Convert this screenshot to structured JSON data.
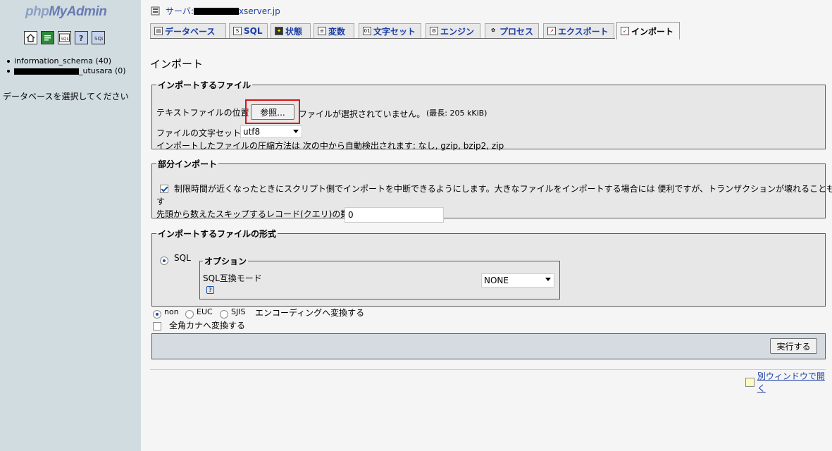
{
  "logo": {
    "part1": "php",
    "part2": "MyAdmin"
  },
  "nav_icons": [
    "home-icon",
    "query-window-icon",
    "sql-docs-icon",
    "help-icon",
    "documentation-icon"
  ],
  "sidebar": {
    "databases": [
      {
        "label": "information_schema (40)"
      },
      {
        "label_suffix": "_utusara (0)"
      }
    ],
    "select_prompt": "データベースを選択してください"
  },
  "server": {
    "prefix": "サーバ: ",
    "suffix": "xserver.jp"
  },
  "tabs": [
    {
      "label": "データベース"
    },
    {
      "label": "SQL"
    },
    {
      "label": "状態"
    },
    {
      "label": "変数"
    },
    {
      "label": "文字セット"
    },
    {
      "label": "エンジン"
    },
    {
      "label": "プロセス"
    },
    {
      "label": "エクスポート"
    },
    {
      "label": "インポート"
    }
  ],
  "page_title": "インポート",
  "file_section": {
    "legend": "インポートするファイル",
    "location_label": "テキストファイルの位置",
    "browse_button": "参照...",
    "no_file_text": "ファイルが選択されていません。",
    "max_size": "(最長: 205 kKiB)",
    "charset_label": "ファイルの文字セット:",
    "charset_value": "utf8",
    "compression_text": "インポートしたファイルの圧縮方法は 次の中から自動検出されます: なし, gzip, bzip2, zip"
  },
  "partial_section": {
    "legend": "部分インポート",
    "interrupt_text_line1": "制限時間が近くなったときにスクリプト側でインポートを中断できるようにします。大きなファイルをインポートする場合には 便利ですが、トランザクションが壊れることもありま",
    "interrupt_text_line2": "す",
    "interrupt_checked": true,
    "skip_label": "先頭から数えたスキップするレコード(クエリ)の数",
    "skip_value": "0"
  },
  "format_section": {
    "legend": "インポートするファイルの形式",
    "sql_label": "SQL",
    "sql_checked": true,
    "options_legend": "オプション",
    "compat_label": "SQL互換モード",
    "compat_value": "NONE",
    "help_glyph": "?"
  },
  "encoding": {
    "options": [
      "non",
      "EUC",
      "SJIS"
    ],
    "selected": "non",
    "convert_label": "エンコーディングへ変換する",
    "kana_label": "全角カナへ変換する",
    "kana_checked": false
  },
  "go_button": "実行する",
  "new_window_link": "別ウィンドウで開く"
}
